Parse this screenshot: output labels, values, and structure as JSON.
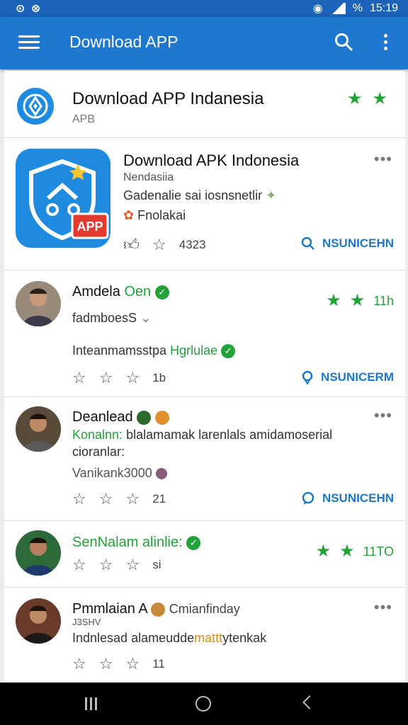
{
  "status": {
    "left": "⊙ ⊗",
    "battery": "%",
    "time": "15:19"
  },
  "appbar": {
    "title": "Download APP"
  },
  "header": {
    "title": "Download APP Indanesia",
    "subtitle": "APB"
  },
  "app": {
    "title": "Download APK Indonesia",
    "line1": "Nendasiia",
    "line2": "Gadenalie sai iosnsnetlir",
    "line3": "Fnolakai",
    "count": "4323",
    "action": "NSUNICEHN",
    "icon_text": "APP"
  },
  "reviews": [
    {
      "name": "Amdela",
      "name_green": "Oen",
      "line1": "fadmboesS",
      "line2_a": "Inteanmamsstpa ",
      "line2_b": "Hgrlulae",
      "count": "1b",
      "rating": "11h",
      "action": "NSUNICERM"
    },
    {
      "name": "Deanlead",
      "line1_green": "Konalnn:",
      "line1_rest": " blalamamak larenlals amidamoserial",
      "line1_cont": "cioranlar:",
      "line2": "Vanikank3000",
      "count": "21",
      "action": "NSUNICEHN"
    },
    {
      "name_green": "SenNalam alinlie:",
      "count": "si",
      "rating": "11TO"
    },
    {
      "name": "Pmmlaian A",
      "name_tail": "Cmianfinday",
      "small": "J3SHV",
      "line1_a": "Indnlesad alameudde",
      "line1_b": "mattt",
      "line1_c": "ytenkak",
      "count": "11"
    }
  ]
}
